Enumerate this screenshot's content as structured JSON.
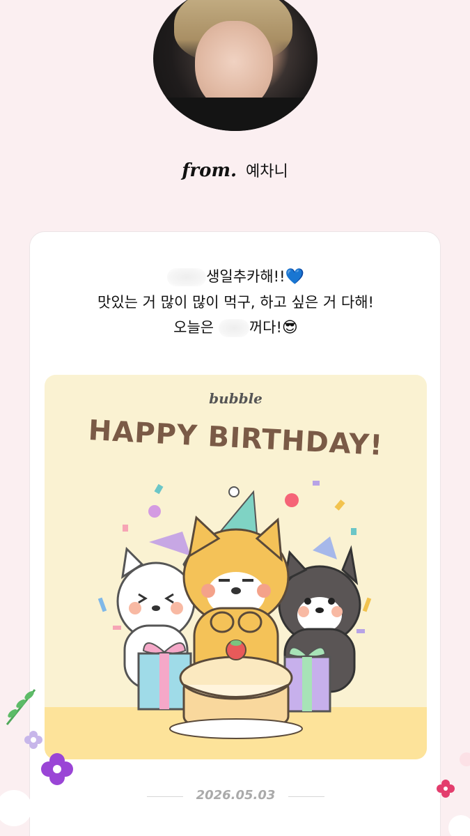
{
  "profile": {
    "from_label": "from.",
    "name": "예차니"
  },
  "message": {
    "line1_text": "생일추카해!!",
    "line1_emoji": "💙",
    "line2": "맛있는 거 많이 많이 먹구, 하고 싶은 거 다해!",
    "line3_start": "오늘은",
    "line3_end": "꺼다!",
    "line3_emoji": "😎"
  },
  "birthday_card": {
    "brand": "bubble",
    "headline": "HAPPY BIRTHDAY!"
  },
  "date": "2026.05.03",
  "colors": {
    "background": "#fbeff1",
    "card_yellow": "#faf2d2",
    "floor": "#fde39a",
    "headline": "#7a5a46"
  }
}
